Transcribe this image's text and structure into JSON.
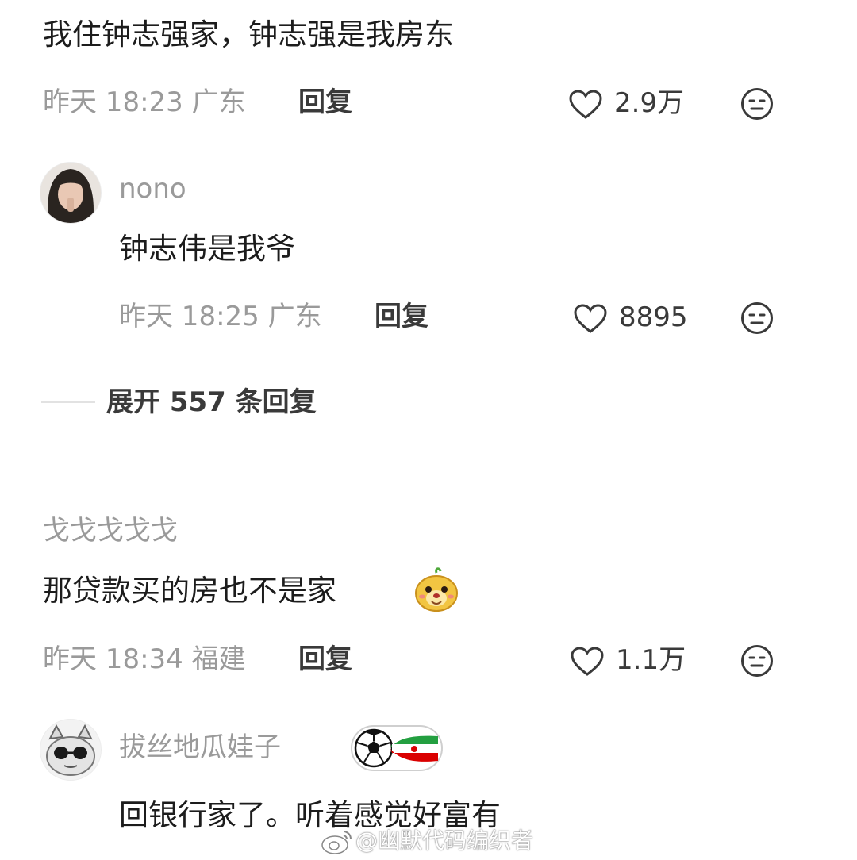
{
  "comments": [
    {
      "text": "我住钟志强家，钟志强是我房东",
      "meta": "昨天 18:23 广东",
      "reply_label": "回复",
      "likes": "2.9万"
    },
    {
      "username": "nono",
      "text": "钟志伟是我爷",
      "meta": "昨天 18:25 广东",
      "reply_label": "回复",
      "likes": "8895"
    },
    {
      "username": "戈戈戈戈戈",
      "text": "那贷款买的房也不是家",
      "meta": "昨天 18:34 福建",
      "reply_label": "回复",
      "likes": "1.1万"
    },
    {
      "username": "拔丝地瓜娃子",
      "text": "回银行家了。听着感觉好富有"
    }
  ],
  "expand_replies": "展开 557 条回复",
  "watermark": "@幽默代码编织者",
  "icons": {
    "like": "heart-outline-icon",
    "dislike": "meh-face-icon",
    "emoji": "dog-sticker-emoji",
    "badge": "football-iran-flag-badge",
    "weibo": "weibo-logo-icon"
  },
  "colors": {
    "text": "#1c1c1c",
    "meta": "#9a9a9a",
    "action": "#3a3a3a",
    "iran_green": "#239f40",
    "iran_red": "#da0000"
  }
}
